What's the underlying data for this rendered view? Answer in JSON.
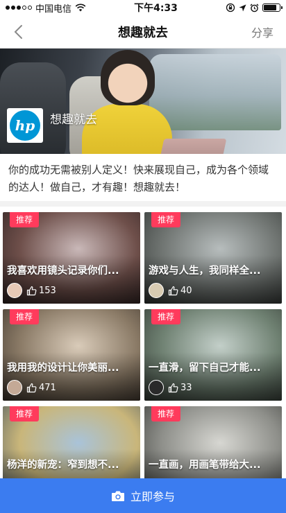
{
  "status_bar": {
    "carrier": "中国电信",
    "time": "下午4:33",
    "battery_level": 0.8,
    "signal_bars": 3,
    "signal_total": 5
  },
  "nav": {
    "title": "想趣就去",
    "share_label": "分享"
  },
  "banner": {
    "brand_name": "想趣就去",
    "logo_text": "hp"
  },
  "description": "你的成功无需被别人定义！快来展现自己，成为各个领域的达人！做自己，才有趣！想趣就去！",
  "badge_label": "推荐",
  "cards": [
    {
      "title": "我喜欢用镜头记录你们...",
      "likes": "153",
      "thumb_colors": [
        "#c9b8b8",
        "#6e4f4a",
        "#2f2222"
      ],
      "avatar_color": "#e7c9b6"
    },
    {
      "title": "游戏与人生，我同样全...",
      "likes": "40",
      "thumb_colors": [
        "#b7bdbd",
        "#6f7471",
        "#323634"
      ],
      "avatar_color": "#d8cbb2"
    },
    {
      "title": "我用我的设计让你美丽...",
      "likes": "471",
      "thumb_colors": [
        "#d9cbb9",
        "#8a7a66",
        "#3d342c"
      ],
      "avatar_color": "#c4a996"
    },
    {
      "title": "一直滑，留下自己才能...",
      "likes": "33",
      "thumb_colors": [
        "#c3cfc9",
        "#6f8172",
        "#343b35"
      ],
      "avatar_color": "#2a2a2a"
    },
    {
      "title": "杨洋的新宠：窄到想不...",
      "likes": "",
      "thumb_colors": [
        "#a9c3d9",
        "#c9b67a",
        "#4e5a63"
      ],
      "avatar_color": "#bfcbd6"
    },
    {
      "title": "一直画，用画笔带给大...",
      "likes": "",
      "thumb_colors": [
        "#d7d7d2",
        "#8e8f8a",
        "#3c3d3a"
      ],
      "avatar_color": "#cccccc"
    }
  ],
  "join_label": "立即参与",
  "colors": {
    "badge": "#ff3b5c",
    "join_bar": "#3b7cf0",
    "hp_blue": "#0096d6"
  },
  "icons": {
    "back": "chevron-left-icon",
    "camera": "camera-icon",
    "like": "thumbs-up-icon",
    "wifi": "wifi-icon",
    "location": "location-arrow-icon",
    "alarm": "alarm-icon",
    "lock_rotation": "orientation-lock-icon"
  }
}
